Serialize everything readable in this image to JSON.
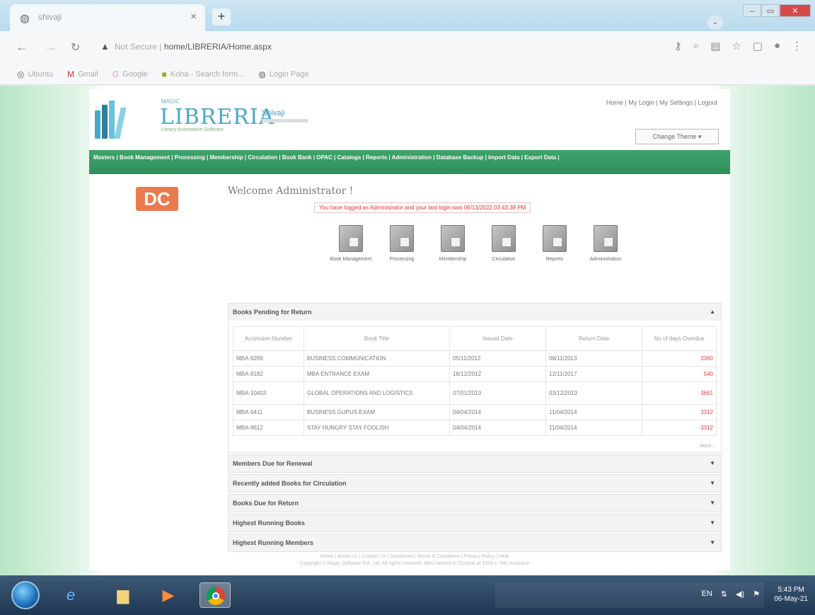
{
  "browser": {
    "tab_title": "shivaji",
    "tab_close": "×",
    "new_tab": "+",
    "url_secure": "Not Secure",
    "url_path": "home/LIBRERIA/Home.aspx",
    "bookmarks": [
      "Ubuntu",
      "Gmail",
      "Google",
      "Koha - Search form...",
      "Login Page"
    ]
  },
  "site": {
    "logo_top": "MAGIC",
    "logo_text": "LIBRERIA",
    "logo_tag": "Library Automation Software",
    "institution": "Shivaji",
    "top_links": "Home | My Login | My Settings | Logout",
    "change_theme": "Change Theme ▾",
    "menu": "Masters | Book Management | Processing | Membership | Circulation | Book Bank | OPAC | Catalogs | Reports | Administration | Database Backup | Import Data | Export Data |",
    "welcome": "Welcome Administrator !",
    "login_message": "You have logged as Administrator and your last login was 06/13/2022 03:43:38 PM",
    "quick_icons": [
      {
        "label": "Book Management"
      },
      {
        "label": "Processing"
      },
      {
        "label": "Membership"
      },
      {
        "label": "Circulation"
      },
      {
        "label": "Reports"
      },
      {
        "label": "Administration"
      }
    ],
    "pending": {
      "title": "Books Pending for Return",
      "columns": [
        "Accession Number",
        "Book Title",
        "Issued Date",
        "Return Date",
        "No of days Overdue"
      ],
      "rows": [
        [
          "MBA-9299",
          "BUSINESS COMMUNICATION",
          "05/11/2012",
          "08/11/2013",
          "3360"
        ],
        [
          "MBA-9182",
          "MBA ENTRANCE EXAM",
          "18/12/2012",
          "12/11/2017",
          "540"
        ],
        [
          "MBA-10403",
          "GLOBAL OPERATIONS AND LOGISTICS",
          "07/01/2013",
          "03/12/2013",
          "3661"
        ],
        [
          "MBA-9411",
          "BUSINESS GUPUS EXAM",
          "04/04/2014",
          "11/04/2014",
          "3312"
        ],
        [
          "MBA-9612",
          "STAY HUNGRY STAY FOOLISH",
          "04/04/2014",
          "11/04/2014",
          "3312"
        ]
      ],
      "more": "More..."
    },
    "panels": [
      "Members Due for Renewal",
      "Recently added Books for Circulation",
      "Books Due for Return",
      "Highest Running Books",
      "Highest Running Members"
    ],
    "footer_line1": "Home | About Us | Contact Us | Disclaimer | Terms & Conditions | Privacy Policy | Help",
    "footer_line2": "Copyright © Magic Software Pvt. Ltd. All rights reserved. Best viewed in Chrome at 1024 x 768 resolution"
  },
  "taskbar": {
    "tray": "EN",
    "time": "5:43 PM",
    "date": "06-May-21"
  }
}
